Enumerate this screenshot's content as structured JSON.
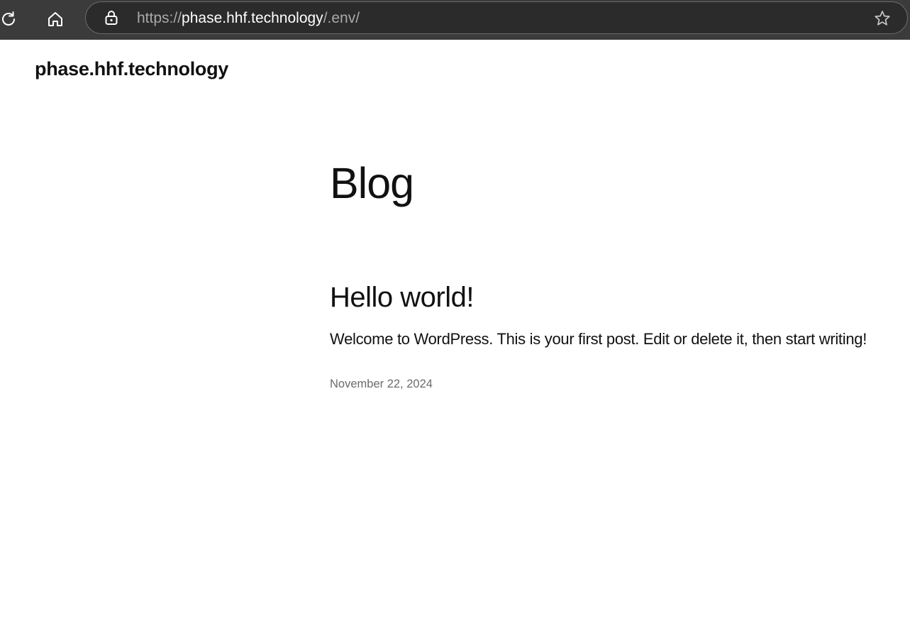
{
  "browser": {
    "url_scheme": "https://",
    "url_host": "phase.hhf.technology",
    "url_path": "/.env/",
    "icons": {
      "reload": "reload-icon",
      "home": "home-icon",
      "lock": "lock-icon",
      "bookmark": "star-icon"
    },
    "colors": {
      "toolbar": "#3b3b3b",
      "address_bar": "#2b2b2b",
      "host_text": "#ffffff",
      "dim_text": "#a9a9a9"
    }
  },
  "site": {
    "title": "phase.hhf.technology"
  },
  "page": {
    "title": "Blog"
  },
  "posts": [
    {
      "title": "Hello world!",
      "excerpt": "Welcome to WordPress. This is your first post. Edit or delete it, then start writing!",
      "date": "November 22, 2024"
    }
  ]
}
